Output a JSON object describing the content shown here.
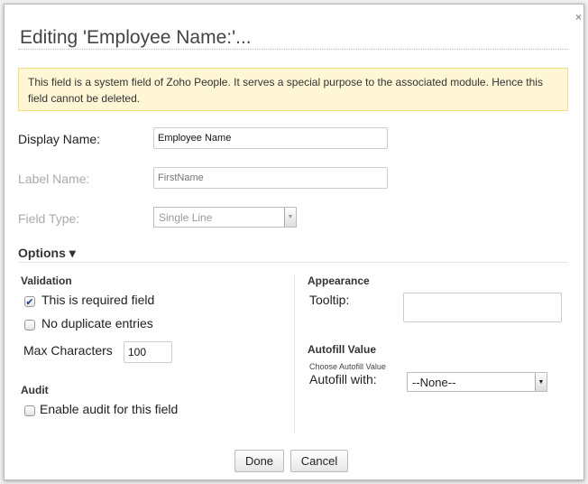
{
  "dialog": {
    "title": "Editing 'Employee Name:'...",
    "close": "×",
    "notice": "This field is a system field of Zoho People. It serves a special purpose to the associated module. Hence this field cannot be deleted."
  },
  "fields": {
    "display_name": {
      "label": "Display Name:",
      "value": "Employee Name"
    },
    "label_name": {
      "label": "Label Name:",
      "placeholder": "FirstName"
    },
    "field_type": {
      "label": "Field Type:",
      "value": "Single Line"
    }
  },
  "options": {
    "label": "Options",
    "caret": "▾",
    "validation": {
      "heading": "Validation",
      "required": "This is required field",
      "required_checked": true,
      "no_duplicate": "No duplicate entries",
      "no_duplicate_checked": false,
      "max_chars_label": "Max Characters",
      "max_chars_value": "100"
    },
    "audit": {
      "heading": "Audit",
      "enable": "Enable audit for this field",
      "enable_checked": false
    },
    "appearance": {
      "heading": "Appearance",
      "tooltip_label": "Tooltip:",
      "tooltip_value": ""
    },
    "autofill": {
      "heading": "Autofill Value",
      "hint": "Choose Autofill Value",
      "label": "Autofill with:",
      "value": "--None--"
    }
  },
  "buttons": {
    "done": "Done",
    "cancel": "Cancel"
  }
}
